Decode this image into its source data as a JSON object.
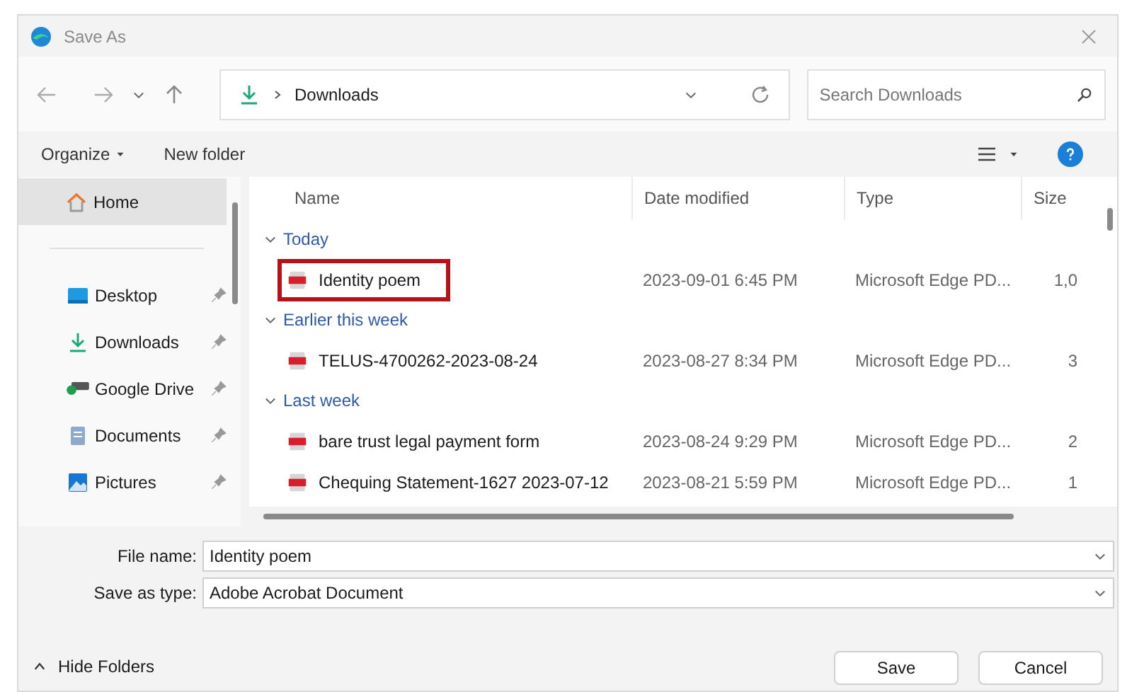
{
  "window": {
    "title": "Save As"
  },
  "address": {
    "path": "Downloads",
    "search_placeholder": "Search Downloads"
  },
  "toolbar": {
    "organize": "Organize",
    "new_folder": "New folder"
  },
  "sidebar": {
    "items": [
      {
        "label": "Home",
        "kind": "home",
        "pinned": false,
        "selected": true
      },
      {
        "label": "Desktop",
        "kind": "desktop",
        "pinned": true,
        "selected": false
      },
      {
        "label": "Downloads",
        "kind": "downloads",
        "pinned": true,
        "selected": false
      },
      {
        "label": "Google Drive",
        "kind": "drive",
        "pinned": true,
        "selected": false
      },
      {
        "label": "Documents",
        "kind": "documents",
        "pinned": true,
        "selected": false
      },
      {
        "label": "Pictures",
        "kind": "pictures",
        "pinned": true,
        "selected": false
      }
    ]
  },
  "table": {
    "columns": [
      "Name",
      "Date modified",
      "Type",
      "Size"
    ],
    "groups": [
      {
        "label": "Today",
        "expanded": true,
        "rows": [
          {
            "name": "Identity poem",
            "date": "2023-09-01 6:45 PM",
            "type": "Microsoft Edge PD...",
            "size": "1,0",
            "outlined": true
          }
        ]
      },
      {
        "label": "Earlier this week",
        "expanded": true,
        "rows": [
          {
            "name": "TELUS-4700262-2023-08-24",
            "date": "2023-08-27 8:34 PM",
            "type": "Microsoft Edge PD...",
            "size": "3",
            "outlined": false
          }
        ]
      },
      {
        "label": "Last week",
        "expanded": true,
        "rows": [
          {
            "name": "bare trust legal payment form",
            "date": "2023-08-24 9:29 PM",
            "type": "Microsoft Edge PD...",
            "size": "2",
            "outlined": false
          },
          {
            "name": "Chequing Statement-1627 2023-07-12",
            "date": "2023-08-21 5:59 PM",
            "type": "Microsoft Edge PD...",
            "size": "1",
            "outlined": false
          }
        ]
      }
    ]
  },
  "form": {
    "file_name_label": "File name:",
    "file_name": "Identity poem",
    "type_label": "Save as type:",
    "type": "Adobe Acrobat Document"
  },
  "footer": {
    "hide_folders": "Hide Folders",
    "save": "Save",
    "cancel": "Cancel"
  }
}
